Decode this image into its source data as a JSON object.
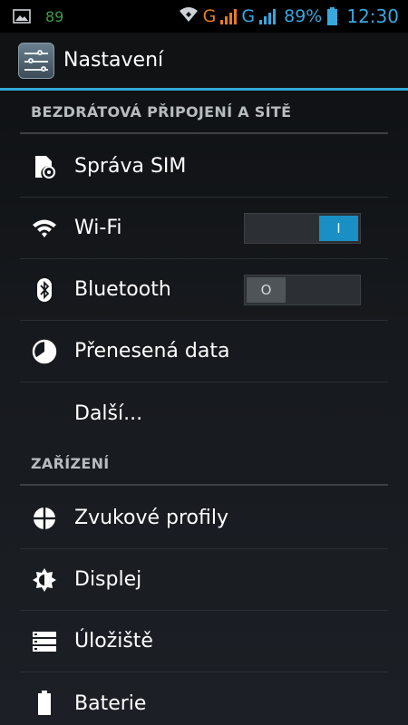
{
  "status_bar": {
    "notification_count": "89",
    "network_1": "G",
    "network_2": "G",
    "battery": "89%",
    "time": "12:30"
  },
  "action_bar": {
    "title": "Nastavení"
  },
  "sections": {
    "wireless": "BEZDRÁTOVÁ PŘIPOJENÍ A SÍTĚ",
    "device": "ZAŘÍZENÍ"
  },
  "items": {
    "sim": "Správa SIM",
    "wifi": "Wi-Fi",
    "bluetooth": "Bluetooth",
    "data": "Přenesená data",
    "more": "Další...",
    "sound": "Zvukové profily",
    "display": "Displej",
    "storage": "Úložiště",
    "battery": "Baterie"
  },
  "toggles": {
    "wifi_state": "I",
    "bluetooth_state": "O"
  },
  "colors": {
    "accent": "#33a6d5",
    "toggle_on": "#1a8fc5",
    "status_green": "#3f9c4a",
    "status_orange": "#e87b22"
  }
}
